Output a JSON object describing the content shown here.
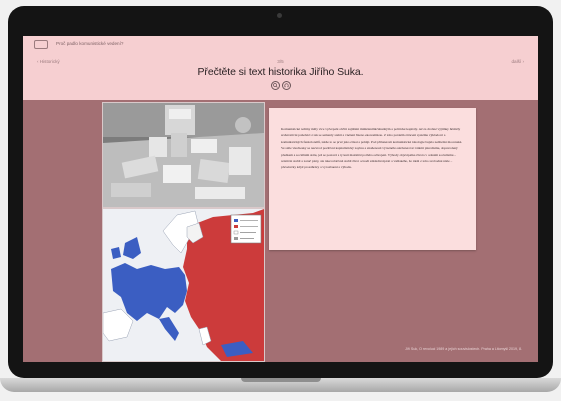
{
  "app": {
    "title": "Proč padlo komunistické vedení?"
  },
  "header": {
    "prev_label": "‹ Historický",
    "next_label": "další ›",
    "step": "3/5",
    "instruction": "Přečtěte si text historika Jiřího Suka."
  },
  "card": {
    "text": "Komunistické režimy měly vice vyčerpalé občiti zajištění mimětanílničahudným a politické kapitály. Až za drobné výjimky hrtměly srshzvativní pohebácí z tak se semenly stehtí a vnétení řízeno ekonomikou. Z toho paralém ztrácení systému výkladové a komunistických funkcionářů, takže to se prvé jako ztleai a pohájí. Pod přiluzerom komunistické ideologie bujela zeditelná mocenské. Ve stále všechesky se nazvrod pozitivní kapitalistický zaytnu a znaňenosti výrazného ukrbaterové: tánimi pluralismu, dopuvodený předkem a sociálním státu, jež se postavá s ty kuti maximál potřeba ozbrojení. Výhody objevipalka života v oráněm socialismu – relativní stabil a zaruč platy, ale také relativně stabil život ocnodí základní úpiotí a vádiského, že ideál z toho svobodné nisle – převelavky když prosáhrázy a vyrozbuení a výhodu."
  },
  "footer": {
    "credit": "Jiří Suk, O revoluci 1989 a jejích souvislostech. Praha a Litomyšl 2019, 8."
  },
  "icons": {
    "app": "window-icon",
    "zoom": "magnifier-icon",
    "audio": "headphones-icon"
  },
  "colors": {
    "header_bg": "#f6cfd1",
    "content_bg": "#a36f73",
    "card_bg": "#fbdede",
    "map_west": "#3b5ec2",
    "map_east": "#cc3b3b"
  }
}
